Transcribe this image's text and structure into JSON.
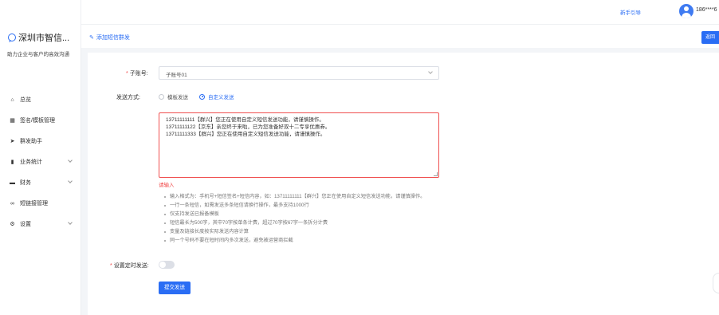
{
  "sidebar": {
    "brand_name": "深圳市智信...",
    "slogan": "助力企业与客户的高效沟通",
    "items": [
      {
        "label": "总览",
        "icon": "home-icon"
      },
      {
        "label": "签名/模板管理",
        "icon": "grid-icon"
      },
      {
        "label": "群发助手",
        "icon": "send-icon"
      },
      {
        "label": "业务统计",
        "icon": "bar-chart-icon",
        "caret": true
      },
      {
        "label": "财务",
        "icon": "wallet-icon",
        "caret": true
      },
      {
        "label": "短链接管理",
        "icon": "link-icon"
      },
      {
        "label": "设置",
        "icon": "gear-icon",
        "caret": true
      }
    ]
  },
  "topbar": {
    "guide_link": "新手引导",
    "user_phone": "186****6"
  },
  "page": {
    "title": "添加短信群发",
    "back_label": "返回"
  },
  "form": {
    "account_label": "子账号:",
    "account_value": "子账号01",
    "send_mode_label": "发送方式:",
    "send_modes": [
      {
        "label": "模板发送",
        "selected": false
      },
      {
        "label": "自定义发送",
        "selected": true
      }
    ],
    "content_lines": [
      "13711111111【群兴】您正在使用自定义短信发送功能，请谨慎操作。",
      "13711111122【京东】亲您终于来啦，已为您准备好双十二专享优惠券。",
      "13711111333【群兴】您正在使用自定义短信发送功能，请谨慎操作。"
    ],
    "error_text": "请输入",
    "tips": [
      "输入格式为：手机号+短信签名+短信内容，如：13711111111【群兴】您正在使用自定义短信发送功能，请谨慎操作。",
      "一行一条短信，如需发送多条短信请换行操作，最多支持1000行",
      "仅支持发送已报备模板",
      "短信最长为500字，其中70字按单条计费，超过70字按67字一条拆分计费",
      "变量及链接长度按实际发送内容计算",
      "同一个号码不要在短时间内多次发送，避免被运营商拦截"
    ],
    "timer_label": "设置定时发送:",
    "submit_label": "提交发送"
  },
  "colors": {
    "accent": "#2a6df4",
    "error": "#f04848"
  }
}
